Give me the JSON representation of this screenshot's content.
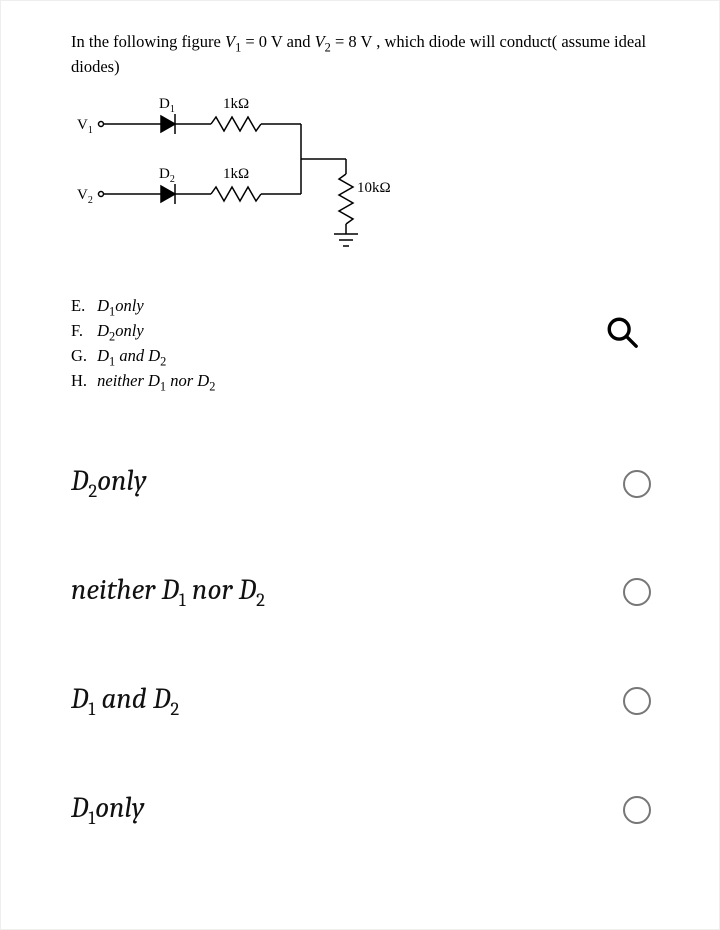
{
  "question": {
    "prefix": "In the following figure ",
    "eq1_lhs": "V",
    "eq1_sub": "1",
    "eq1_rhs": " = 0 V and ",
    "eq2_lhs": "V",
    "eq2_sub": "2",
    "eq2_rhs": " = 8 V ",
    "suffix": ", which diode will conduct( assume ideal diodes)"
  },
  "circuit": {
    "d1": "D",
    "d1_sub": "1",
    "d2": "D",
    "d2_sub": "2",
    "r1": "1kΩ",
    "r2": "1kΩ",
    "rload": "10kΩ",
    "v1": "V",
    "v1_sub": "1",
    "v2": "V",
    "v2_sub": "2"
  },
  "options": [
    {
      "letter": "E.",
      "label_a": "D",
      "sub_a": "1",
      "label_b": "only"
    },
    {
      "letter": "F.",
      "label_a": "D",
      "sub_a": "2",
      "label_b": "only"
    },
    {
      "letter": "G.",
      "label_a": "D",
      "sub_a": "1",
      "mid": " and D",
      "sub_b": "2",
      "label_b": ""
    },
    {
      "letter": "H.",
      "label_a": "neither D",
      "sub_a": "1",
      "mid": " nor D",
      "sub_b": "2",
      "label_b": ""
    }
  ],
  "answers": [
    {
      "pre": "D",
      "sub1": "2",
      "mid": "",
      "sub2": "",
      "post": "only"
    },
    {
      "pre": "neither D",
      "sub1": "1",
      "mid": " nor D",
      "sub2": "2",
      "post": ""
    },
    {
      "pre": "D",
      "sub1": "1",
      "mid": " and D",
      "sub2": "2",
      "post": ""
    },
    {
      "pre": "D",
      "sub1": "1",
      "mid": "",
      "sub2": "",
      "post": "only"
    }
  ],
  "icons": {
    "search": "search-icon"
  }
}
